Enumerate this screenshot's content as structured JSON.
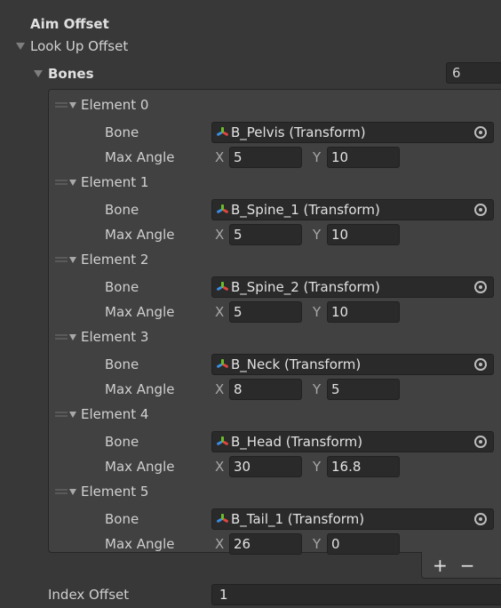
{
  "inspector": {
    "header_title": "Aim Offset",
    "lookup_label": "Look Up Offset",
    "bones_label": "Bones",
    "bones_count": "6",
    "bone_prop_label": "Bone",
    "angle_prop_label": "Max Angle",
    "x_axis": "X",
    "y_axis": "Y",
    "add_button": "+",
    "remove_button": "−",
    "index_offset_label": "Index Offset",
    "index_offset_value": "1"
  },
  "elements": [
    {
      "label": "Element 0",
      "bone": "B_Pelvis (Transform)",
      "x": "5",
      "y": "10"
    },
    {
      "label": "Element 1",
      "bone": "B_Spine_1 (Transform)",
      "x": "5",
      "y": "10"
    },
    {
      "label": "Element 2",
      "bone": "B_Spine_2 (Transform)",
      "x": "5",
      "y": "10"
    },
    {
      "label": "Element 3",
      "bone": "B_Neck (Transform)",
      "x": "8",
      "y": "5"
    },
    {
      "label": "Element 4",
      "bone": "B_Head (Transform)",
      "x": "30",
      "y": "16.8"
    },
    {
      "label": "Element 5",
      "bone": "B_Tail_1 (Transform)",
      "x": "26",
      "y": "0"
    }
  ],
  "icons": {
    "foldout": "triangle-down-icon",
    "drag": "drag-handle-icon",
    "transform": "transform-icon",
    "picker": "object-picker-icon"
  },
  "colors": {
    "background": "#383838",
    "field": "#2a2a2a",
    "panel": "#414141",
    "text": "#d2d2d2"
  }
}
